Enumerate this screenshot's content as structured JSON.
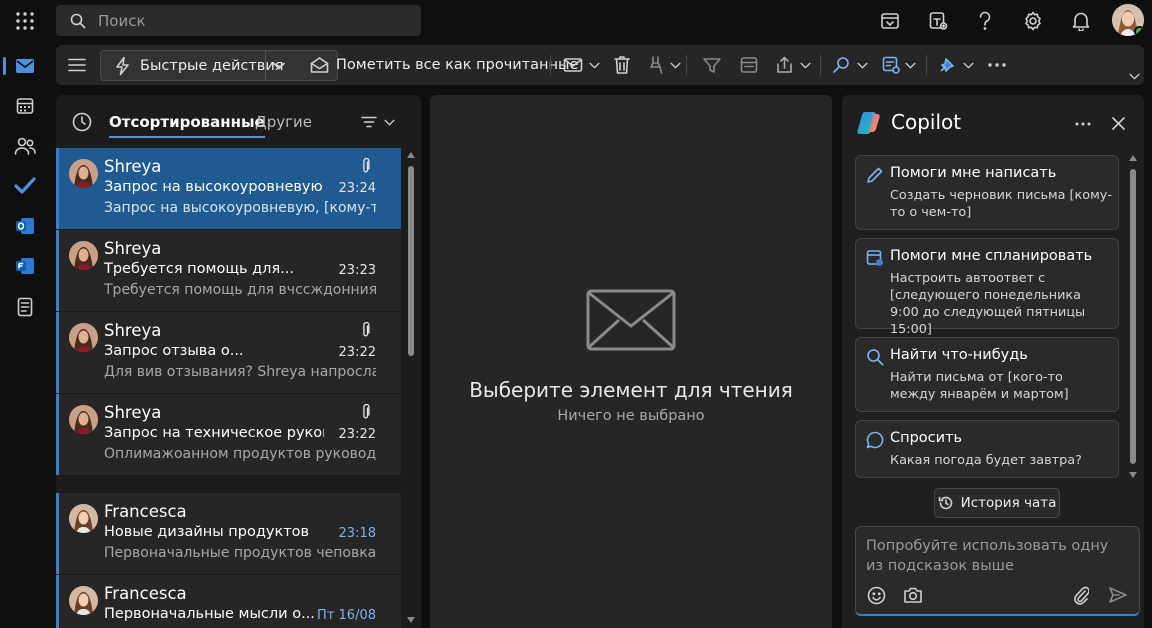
{
  "search": {
    "placeholder": "Поиск"
  },
  "ribbon": {
    "quick_actions": "Быстрые действия",
    "mark_all_read": "Пометить все как прочитанные"
  },
  "list": {
    "tab_focused": "Отсортированные",
    "tab_other": "Другие",
    "messages": [
      {
        "from": "Shreya",
        "subject": "Запрос на высокоуровневую...",
        "time": "23:24",
        "preview": "Запрос на высокоуровневую, [кому-то ...",
        "attachment": true,
        "selected": true
      },
      {
        "from": "Shreya",
        "subject": "Требуется помощь для...",
        "time": "23:23",
        "preview": "Требуется помощь для вчссждонния т...",
        "attachment": false
      },
      {
        "from": "Shreya",
        "subject": "Запрос отзыва о...",
        "time": "23:22",
        "preview": "Для вив отзывания? Shreya напросла да...",
        "attachment": true
      },
      {
        "from": "Shreya",
        "subject": "Запрос на техническое руковод...",
        "time": "23:22",
        "preview": "Оплимажоанном продуктов руководств...",
        "attachment": true
      },
      {
        "from": "Francesca",
        "subject": "Новые дизайны продуктов",
        "time": "23:18",
        "preview": "Первоначальные продуктов чеповкам и...",
        "attachment": false
      },
      {
        "from": "Francesca",
        "subject": "Первоначальные мысли о...",
        "time": "Пт 16/08",
        "preview": "",
        "attachment": false
      }
    ]
  },
  "reading": {
    "title": "Выберите элемент для чтения",
    "subtitle": "Ничего не выбрано"
  },
  "copilot": {
    "title": "Copilot",
    "cards": [
      {
        "heading": "Помоги мне написать",
        "desc": "Создать черновик письма [кому-то о чем-то]"
      },
      {
        "heading": "Помоги мне спланировать",
        "desc": "Настроить автоответ с [следующего понедельника 9:00 до следующей пятницы 15:00]"
      },
      {
        "heading": "Найти что-нибудь",
        "desc": "Найти письма от [кого-то между январём и мартом]"
      },
      {
        "heading": "Спросить",
        "desc": "Какая погода будет завтра?"
      }
    ],
    "history": "История чата",
    "composer_placeholder": "Попробуйте использовать одну из подсказок выше"
  },
  "colors": {
    "accent": "#3c7fd0",
    "selected_row": "#1f5b91",
    "presence": "#4ab04a"
  }
}
